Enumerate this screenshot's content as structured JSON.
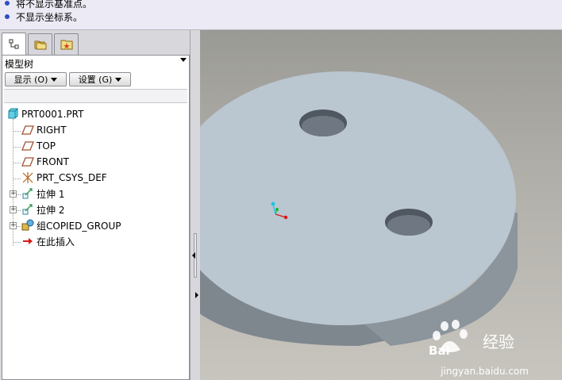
{
  "messages": [
    "将不显示基准点。",
    "不显示坐标系。"
  ],
  "panel": {
    "title": "模型树",
    "show_button": "显示 (O)",
    "settings_button": "设置 (G)"
  },
  "tree": {
    "root": "PRT0001.PRT",
    "items": [
      {
        "label": "RIGHT",
        "icon": "datum-plane-icon"
      },
      {
        "label": "TOP",
        "icon": "datum-plane-icon"
      },
      {
        "label": "FRONT",
        "icon": "datum-plane-icon"
      },
      {
        "label": "PRT_CSYS_DEF",
        "icon": "csys-icon"
      },
      {
        "label": "拉伸 1",
        "icon": "extrude-icon",
        "expandable": true
      },
      {
        "label": "拉伸 2",
        "icon": "extrude-icon",
        "expandable": true
      },
      {
        "label": "组COPIED_GROUP",
        "icon": "group-icon",
        "expandable": true
      },
      {
        "label": "在此插入",
        "icon": "insert-here-arrow-icon"
      }
    ]
  },
  "watermark": {
    "text": "经验",
    "url": "jingyan.baidu.com"
  },
  "colors": {
    "part_surface": "#b9c5cf",
    "part_side": "#828a92",
    "background": "#b4b2ac",
    "bullet": "#2b4fc9"
  }
}
